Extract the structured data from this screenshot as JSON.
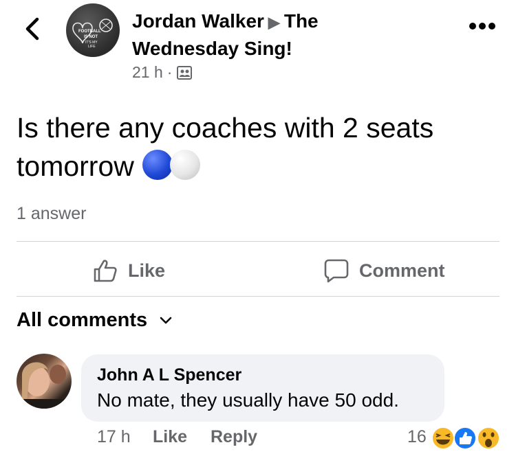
{
  "header": {
    "author": "Jordan Walker",
    "group": "The Wednesday Sing!",
    "time": "21 h",
    "dot": "·",
    "avatar_text": [
      "FOOTBALL",
      "IS NOT",
      "IT'S MY",
      "LIFE"
    ]
  },
  "post": {
    "text": "Is there any coaches with 2 seats tomorrow",
    "answers": "1 answer"
  },
  "actions": {
    "like": "Like",
    "comment": "Comment"
  },
  "comments_section": {
    "filter_label": "All comments"
  },
  "comment": {
    "author": "John A L Spencer",
    "text": "No mate, they usually have 50 odd.",
    "time": "17 h",
    "like": "Like",
    "reply": "Reply",
    "reaction_count": "16"
  },
  "colors": {
    "secondary_text": "#65676b",
    "bubble": "#f0f2f5",
    "like_blue": "#1877f2",
    "emoji_yellow": "#f7b928"
  },
  "icons": [
    "back-arrow-icon",
    "more-icon",
    "group-members-icon",
    "like-thumb-icon",
    "comment-bubble-icon",
    "chevron-down-icon",
    "haha-reaction-icon",
    "like-reaction-icon",
    "wow-reaction-icon"
  ]
}
